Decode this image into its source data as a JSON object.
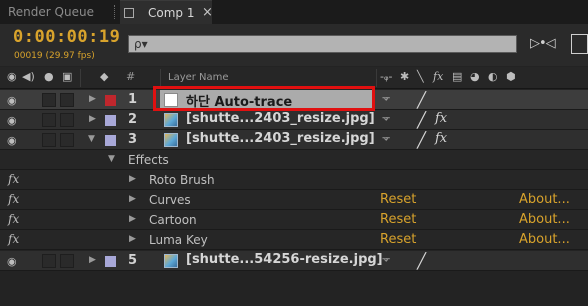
{
  "tabs": {
    "render_queue": "Render Queue",
    "comp": "Comp 1"
  },
  "toolbar": {
    "timecode": "0:00:00:19",
    "framecount": "00019 (29.97 fps)",
    "search_glyph": "ρ▾"
  },
  "header": {
    "hash": "#",
    "layer_name": "Layer Name"
  },
  "layers": [
    {
      "num": "1",
      "name": "하단 Auto-trace",
      "label_color": "#c0272d",
      "thumb": "solid-white"
    },
    {
      "num": "2",
      "name": "[shutte...2403_resize.jpg]",
      "label_color": "#a8a8d8",
      "thumb": "image"
    },
    {
      "num": "3",
      "name": "[shutte...2403_resize.jpg]",
      "label_color": "#a8a8d8",
      "thumb": "image"
    },
    {
      "num": "5",
      "name": "[shutte...54256-resize.jpg]",
      "label_color": "#a8a8d8",
      "thumb": "image"
    }
  ],
  "effects": {
    "group_label": "Effects",
    "items": [
      {
        "name": "Roto Brush",
        "reset": "",
        "about": ""
      },
      {
        "name": "Curves",
        "reset": "Reset",
        "about": "About..."
      },
      {
        "name": "Cartoon",
        "reset": "Reset",
        "about": "About..."
      },
      {
        "name": "Luma Key",
        "reset": "Reset",
        "about": "About..."
      }
    ]
  },
  "glyphs": {
    "fx": "fx",
    "switch": "-ᵩ-",
    "slash": "╱"
  },
  "colors": {
    "accent_orange": "#d8a32c",
    "highlight_red": "#e01010"
  }
}
